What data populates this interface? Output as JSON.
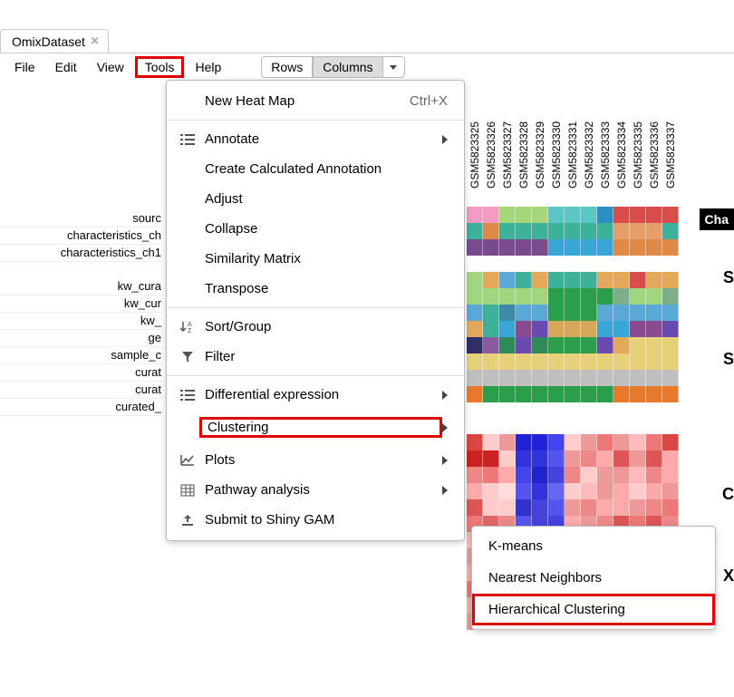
{
  "tab": {
    "title": "OmixDataset"
  },
  "menubar": {
    "file": "File",
    "edit": "Edit",
    "view": "View",
    "tools": "Tools",
    "help": "Help",
    "rows": "Rows",
    "columns": "Columns"
  },
  "dropdown": {
    "new_heat_map": "New Heat Map",
    "new_heat_map_shortcut": "Ctrl+X",
    "annotate": "Annotate",
    "create_calc": "Create Calculated Annotation",
    "adjust": "Adjust",
    "collapse": "Collapse",
    "similarity": "Similarity Matrix",
    "transpose": "Transpose",
    "sort_group": "Sort/Group",
    "filter": "Filter",
    "diff_expr": "Differential expression",
    "clustering": "Clustering",
    "plots": "Plots",
    "pathway": "Pathway analysis",
    "submit_shiny": "Submit to Shiny GAM"
  },
  "submenu": {
    "kmeans": "K-means",
    "nearest": "Nearest Neighbors",
    "hierarchical": "Hierarchical Clustering"
  },
  "row_labels": [
    "sourc",
    "characteristics_ch",
    "characteristics_ch1",
    "kw_cura",
    "kw_cur",
    "kw_",
    "ge",
    "sample_c",
    "curat",
    "curat",
    "curated_"
  ],
  "col_labels": [
    "GSM5823325",
    "GSM5823326",
    "GSM5823327",
    "GSM5823328",
    "GSM5823329",
    "GSM5823330",
    "GSM5823331",
    "GSM5823332",
    "GSM5823333",
    "GSM5823334",
    "GSM5823335",
    "GSM5823336",
    "GSM5823337"
  ],
  "right_badge": "Cha",
  "right_letters": [
    "S",
    "S",
    "C",
    "X"
  ],
  "heatmap_colors": {
    "annotations": [
      [
        "#f59ac0",
        "#f59ac0",
        "#a4d67a",
        "#a4d67a",
        "#a4d67a",
        "#5bc6c4",
        "#5bc6c4",
        "#5bc6c4",
        "#2c8fc4",
        "#d84c4c",
        "#d84c4c",
        "#d84c4c",
        "#d84c4c"
      ],
      [
        "#3db19a",
        "#e08a4a",
        "#3db19a",
        "#3db19a",
        "#3db19a",
        "#3db19a",
        "#3db19a",
        "#3db19a",
        "#3db19a",
        "#e69e6a",
        "#e69e6a",
        "#e69e6a",
        "#3db19a"
      ],
      [
        "#7a4a8f",
        "#7a4a8f",
        "#7a4a8f",
        "#7a4a8f",
        "#7a4a8f",
        "#3aa6d6",
        "#3aa6d6",
        "#3aa6d6",
        "#3aa6d6",
        "#e08a4a",
        "#e08a4a",
        "#e08a4a",
        "#e08a4a"
      ],
      [
        "#9fd67f",
        "#e3a95a",
        "#5aa9d6",
        "#3db19a",
        "#e3a95a",
        "#3db19a",
        "#3db19a",
        "#3db19a",
        "#e3a95a",
        "#e3a95a",
        "#d84c4c",
        "#e3a95a",
        "#e3a95a"
      ],
      [
        "#9fd67f",
        "#9fd67f",
        "#9fd67f",
        "#9fd67f",
        "#9fd67f",
        "#2a9e4a",
        "#2a9e4a",
        "#2a9e4a",
        "#2a9e4a",
        "#7db08a",
        "#9fd67f",
        "#9fd67f",
        "#7db08a"
      ],
      [
        "#5aa9d6",
        "#3db19a",
        "#3d8aa6",
        "#5aa9d6",
        "#5aa9d6",
        "#2a9e4a",
        "#2a9e4a",
        "#2a9e4a",
        "#5aa9d6",
        "#5aa9d6",
        "#5aa9d6",
        "#5aa9d6",
        "#5aa9d6"
      ],
      [
        "#e3a95a",
        "#3db19a",
        "#3aa6d6",
        "#8a4a8f",
        "#6a4ab0",
        "#d6a95a",
        "#d6a95a",
        "#d6a95a",
        "#3aa6d6",
        "#3aa6d6",
        "#8a4a8f",
        "#8a4a8f",
        "#6a4ab0"
      ],
      [
        "#2f2f6a",
        "#8a5aa0",
        "#2f8a5a",
        "#6a4ab0",
        "#2f8a5a",
        "#2a9e4a",
        "#2a9e4a",
        "#2a9e4a",
        "#6a4ab0",
        "#e3a95a",
        "#e6d07a",
        "#e6d07a",
        "#e6d07a"
      ],
      [
        "#e6d07a",
        "#e6d07a",
        "#e6d07a",
        "#e6d07a",
        "#e6d07a",
        "#e6d07a",
        "#e6d07a",
        "#e6d07a",
        "#e6d07a",
        "#e6d07a",
        "#e6d07a",
        "#e6d07a",
        "#e6d07a"
      ],
      [
        "#bfbfbf",
        "#bfbfbf",
        "#bfbfbf",
        "#bfbfbf",
        "#bfbfbf",
        "#bfbfbf",
        "#bfbfbf",
        "#bfbfbf",
        "#bfbfbf",
        "#bfbfbf",
        "#bfbfbf",
        "#bfbfbf",
        "#bfbfbf"
      ],
      [
        "#e67a2a",
        "#2a9e4a",
        "#2a9e4a",
        "#2a9e4a",
        "#2a9e4a",
        "#2a9e4a",
        "#2a9e4a",
        "#2a9e4a",
        "#2a9e4a",
        "#e67a2a",
        "#e67a2a",
        "#e67a2a",
        "#e67a2a"
      ]
    ],
    "expression": [
      [
        "#d44",
        "#fcc",
        "#e99",
        "#22d",
        "#22d",
        "#44e",
        "#fcc",
        "#e99",
        "#e77",
        "#e99",
        "#fbb",
        "#e77",
        "#d44"
      ],
      [
        "#c22",
        "#c22",
        "#fcc",
        "#33d",
        "#33d",
        "#55e",
        "#e99",
        "#e88",
        "#faa",
        "#d55",
        "#e99",
        "#d55",
        "#faa"
      ],
      [
        "#e88",
        "#e77",
        "#faa",
        "#44e",
        "#22c",
        "#44d",
        "#e88",
        "#fcc",
        "#e99",
        "#e99",
        "#fbb",
        "#e88",
        "#faa"
      ],
      [
        "#faa",
        "#fcc",
        "#fdd",
        "#55e",
        "#33d",
        "#66e",
        "#fcc",
        "#fbb",
        "#e99",
        "#faa",
        "#fcc",
        "#faa",
        "#e99"
      ],
      [
        "#d55",
        "#fcc",
        "#fcc",
        "#33c",
        "#44d",
        "#55e",
        "#e99",
        "#e88",
        "#faa",
        "#faa",
        "#e99",
        "#e88",
        "#e77"
      ],
      [
        "#e77",
        "#d66",
        "#e88",
        "#55e",
        "#44d",
        "#44d",
        "#faa",
        "#e99",
        "#e88",
        "#d55",
        "#e77",
        "#d55",
        "#e88"
      ],
      [
        "#fbb",
        "#e99",
        "#faa",
        "#22c",
        "#33d",
        "#55e",
        "#e99",
        "#faa",
        "#faa",
        "#e99",
        "#faa",
        "#e99",
        "#e88"
      ],
      [
        "#e99",
        "#faa",
        "#e88",
        "#44d",
        "#33c",
        "#55e",
        "#faa",
        "#e99",
        "#e99",
        "#e99",
        "#faa",
        "#e99",
        "#faa"
      ],
      [
        "#faa",
        "#e88",
        "#e99",
        "#33d",
        "#44d",
        "#66e",
        "#faa",
        "#fbb",
        "#e99",
        "#faa",
        "#e77",
        "#faa",
        "#e99"
      ],
      [
        "#e77",
        "#faa",
        "#d66",
        "#55e",
        "#44d",
        "#55e",
        "#e99",
        "#e88",
        "#faa",
        "#e77",
        "#faa",
        "#e99",
        "#d55"
      ],
      [
        "#faa",
        "#e99",
        "#fcc",
        "#44d",
        "#22c",
        "#44d",
        "#22c",
        "#e99",
        "#e99",
        "#faa",
        "#33c",
        "#22c",
        "#e99"
      ],
      [
        "#e99",
        "#faa",
        "#e88",
        "#33d",
        "#33d",
        "#44d",
        "#e99",
        "#faa",
        "#e99",
        "#e99",
        "#44d",
        "#33c",
        "#faa"
      ]
    ]
  }
}
